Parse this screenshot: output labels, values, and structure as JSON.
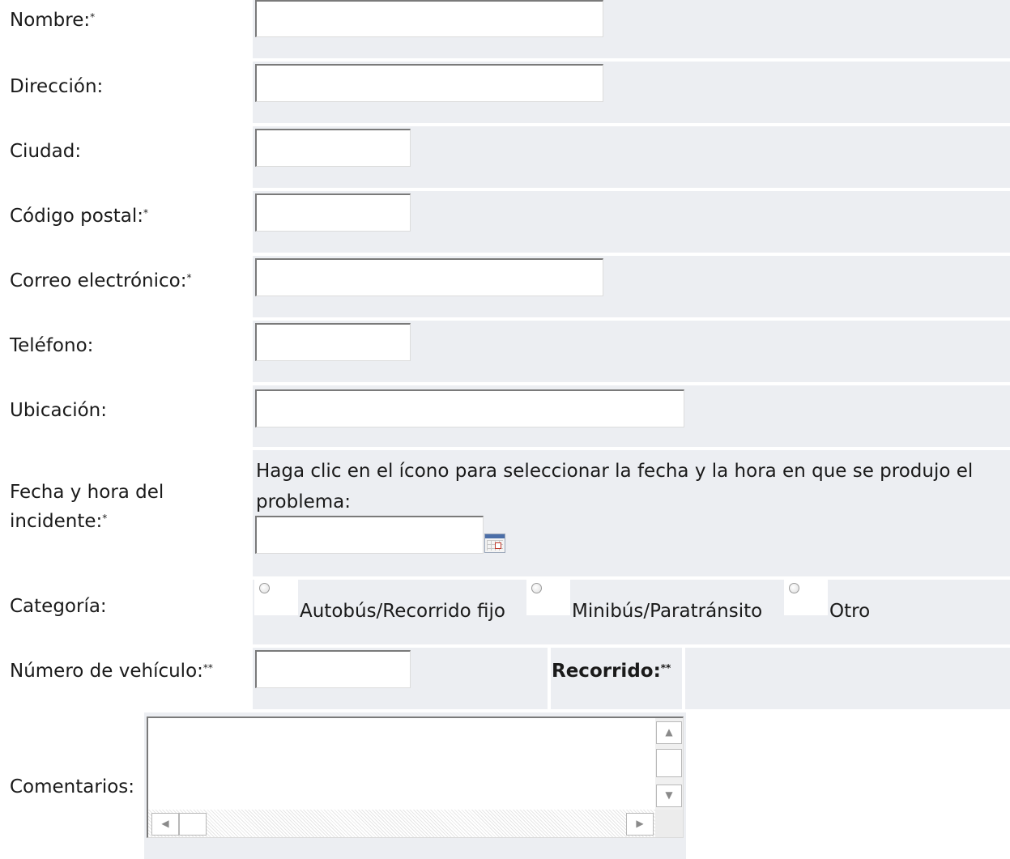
{
  "form": {
    "fields": {
      "nombre": {
        "label": "Nombre:",
        "mark": "*",
        "value": ""
      },
      "direccion": {
        "label": "Dirección:",
        "value": ""
      },
      "ciudad": {
        "label": "Ciudad:",
        "value": ""
      },
      "codigo_postal": {
        "label": "Código postal:",
        "mark": "*",
        "value": ""
      },
      "correo": {
        "label": "Correo electrónico:",
        "mark": "*",
        "value": ""
      },
      "telefono": {
        "label": "Teléfono:",
        "value": ""
      },
      "ubicacion": {
        "label": "Ubicación:",
        "value": ""
      },
      "fecha": {
        "label_line1": "Fecha y hora del",
        "label_line2": "incidente:",
        "mark": "*",
        "instructions_line1": "Haga clic en el ícono para seleccionar la fecha y la hora en que se produjo el",
        "instructions_line2": "problema:",
        "value": "",
        "icon": "calendar-icon"
      },
      "categoria": {
        "label": "Categoría:",
        "options": [
          "Autobús/Recorrido fijo",
          "Minibús/Paratránsito",
          "Otro"
        ],
        "selected": null
      },
      "vehiculo": {
        "label": "Número de vehículo:",
        "mark": "**",
        "value": ""
      },
      "recorrido": {
        "label": "Recorrido:",
        "mark": "**"
      },
      "comentarios": {
        "label": "Comentarios:",
        "value": ""
      }
    },
    "colors": {
      "cell_background": "#eceef2",
      "page_background": "#ffffff"
    }
  }
}
